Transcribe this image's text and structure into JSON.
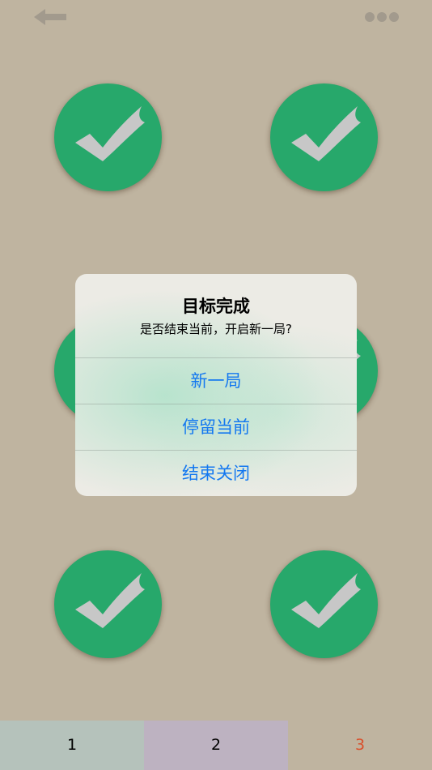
{
  "topbar": {
    "back_icon": "back-arrow-icon",
    "more_icon": "more-dots-icon"
  },
  "grid": {
    "items": [
      {
        "state": "completed",
        "icon": "checkmark-icon"
      },
      {
        "state": "completed",
        "icon": "checkmark-icon"
      },
      {
        "state": "completed",
        "icon": "checkmark-icon"
      },
      {
        "state": "completed",
        "icon": "checkmark-icon"
      },
      {
        "state": "completed",
        "icon": "checkmark-icon"
      },
      {
        "state": "completed",
        "icon": "checkmark-icon"
      }
    ]
  },
  "alert": {
    "title": "目标完成",
    "message": "是否结束当前，开启新一局?",
    "buttons": [
      {
        "label": "新一局"
      },
      {
        "label": "停留当前"
      },
      {
        "label": "结束关闭"
      }
    ]
  },
  "tabs": [
    {
      "label": "1",
      "color": "#b5c2bb"
    },
    {
      "label": "2",
      "color": "#bdb2c1"
    },
    {
      "label": "3",
      "color": "#bfb4a0",
      "text_color": "#d9502c"
    }
  ],
  "colors": {
    "background": "#bfb4a0",
    "circle": "#27a86b",
    "check": "#c7c7c7",
    "alert_button_text": "#1478f0"
  }
}
